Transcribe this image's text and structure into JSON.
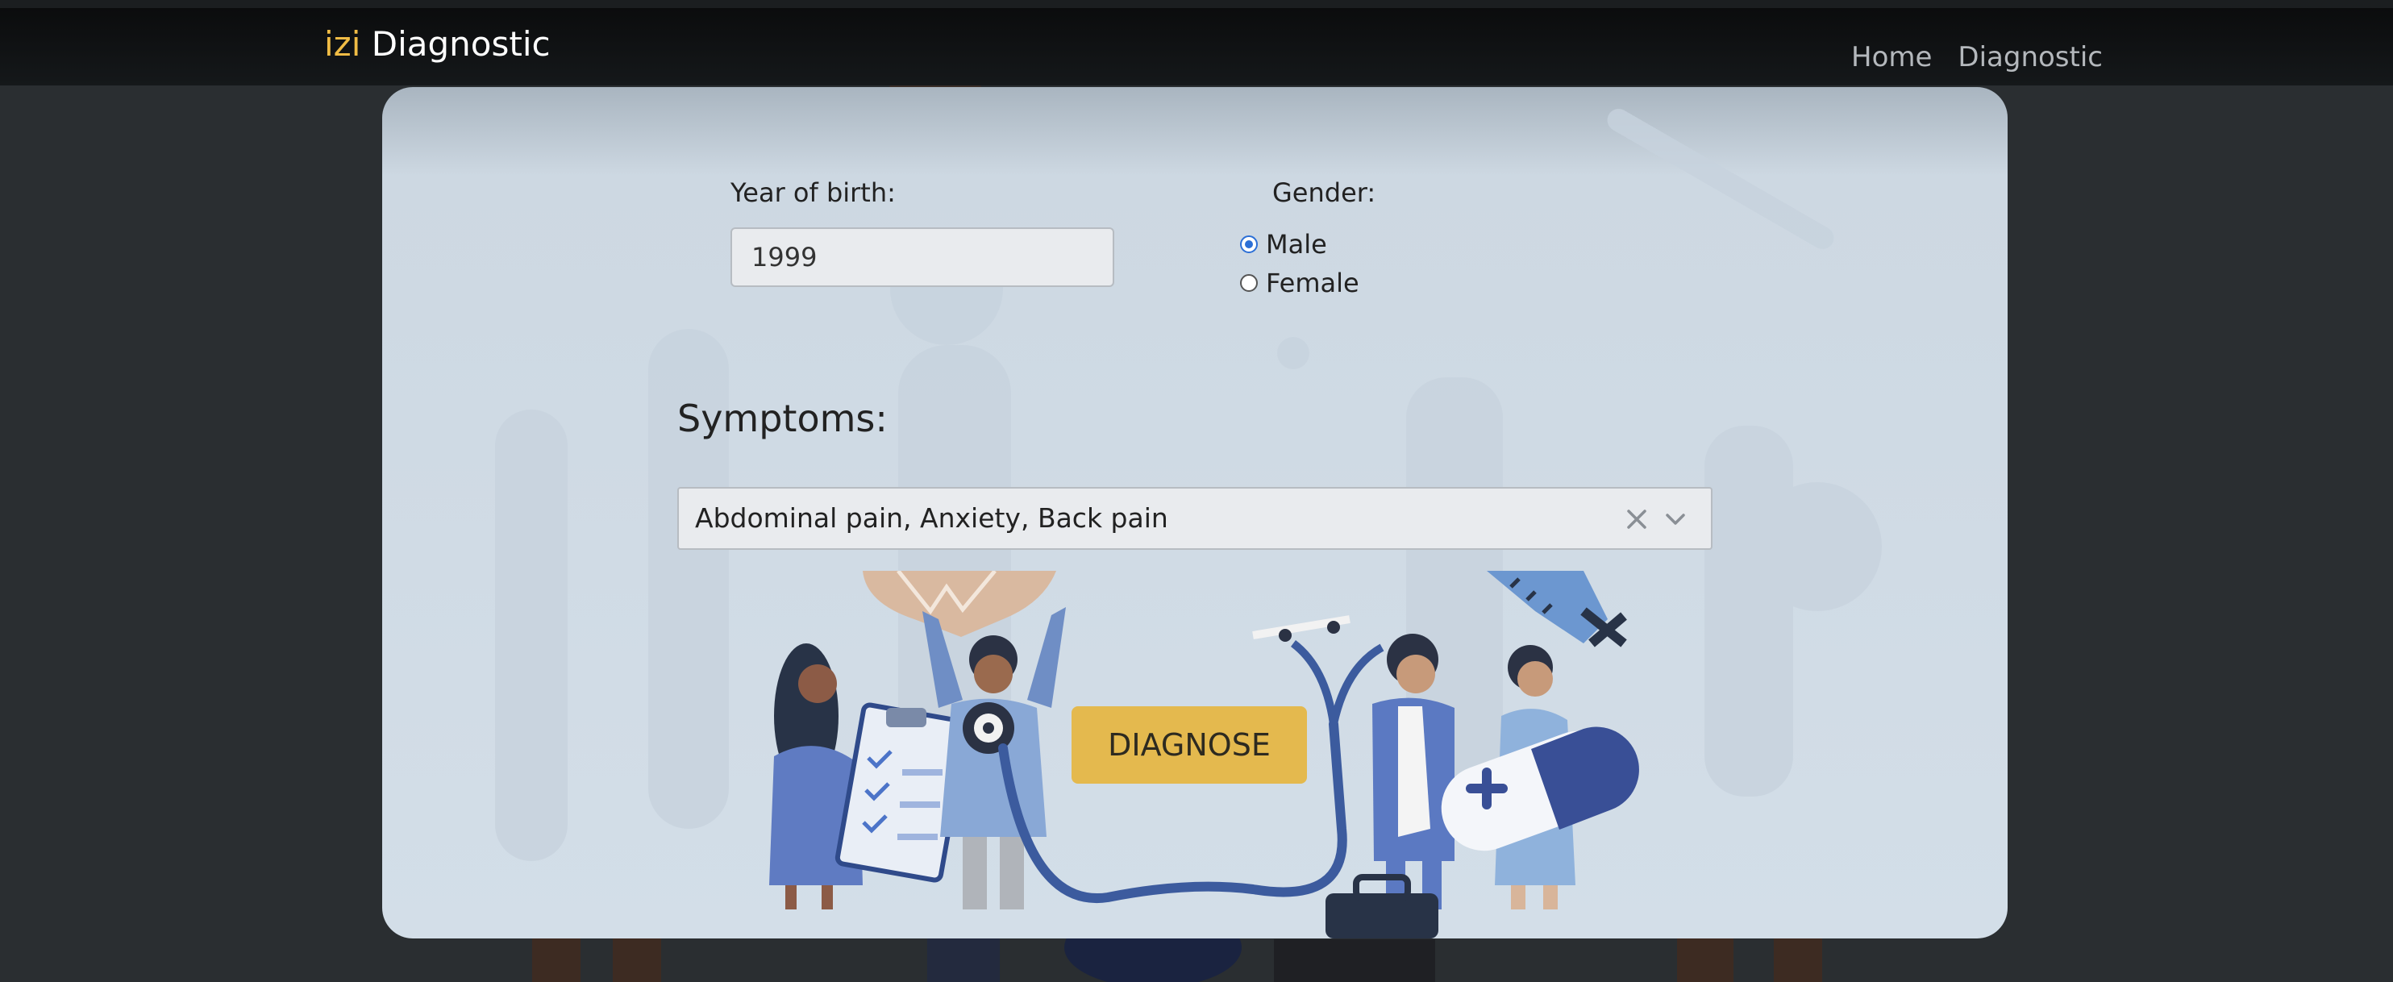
{
  "brand": {
    "accent": "izi",
    "name": "Diagnostic"
  },
  "nav": {
    "items": [
      {
        "label": "Home"
      },
      {
        "label": "Diagnostic"
      }
    ]
  },
  "form": {
    "year_label": "Year of birth:",
    "year_value": "1999",
    "gender_label": "Gender:",
    "gender_options": [
      {
        "label": "Male",
        "checked": true
      },
      {
        "label": "Female",
        "checked": false
      }
    ]
  },
  "symptoms": {
    "title": "Symptoms:",
    "selected": "Abdominal pain, Anxiety, Back pain"
  },
  "diagnose_label": "DIAGNOSE",
  "colors": {
    "accent": "#f0bc45",
    "button": "#e4b94e",
    "card": "#d3dee8",
    "radio": "#2c6fd6"
  }
}
